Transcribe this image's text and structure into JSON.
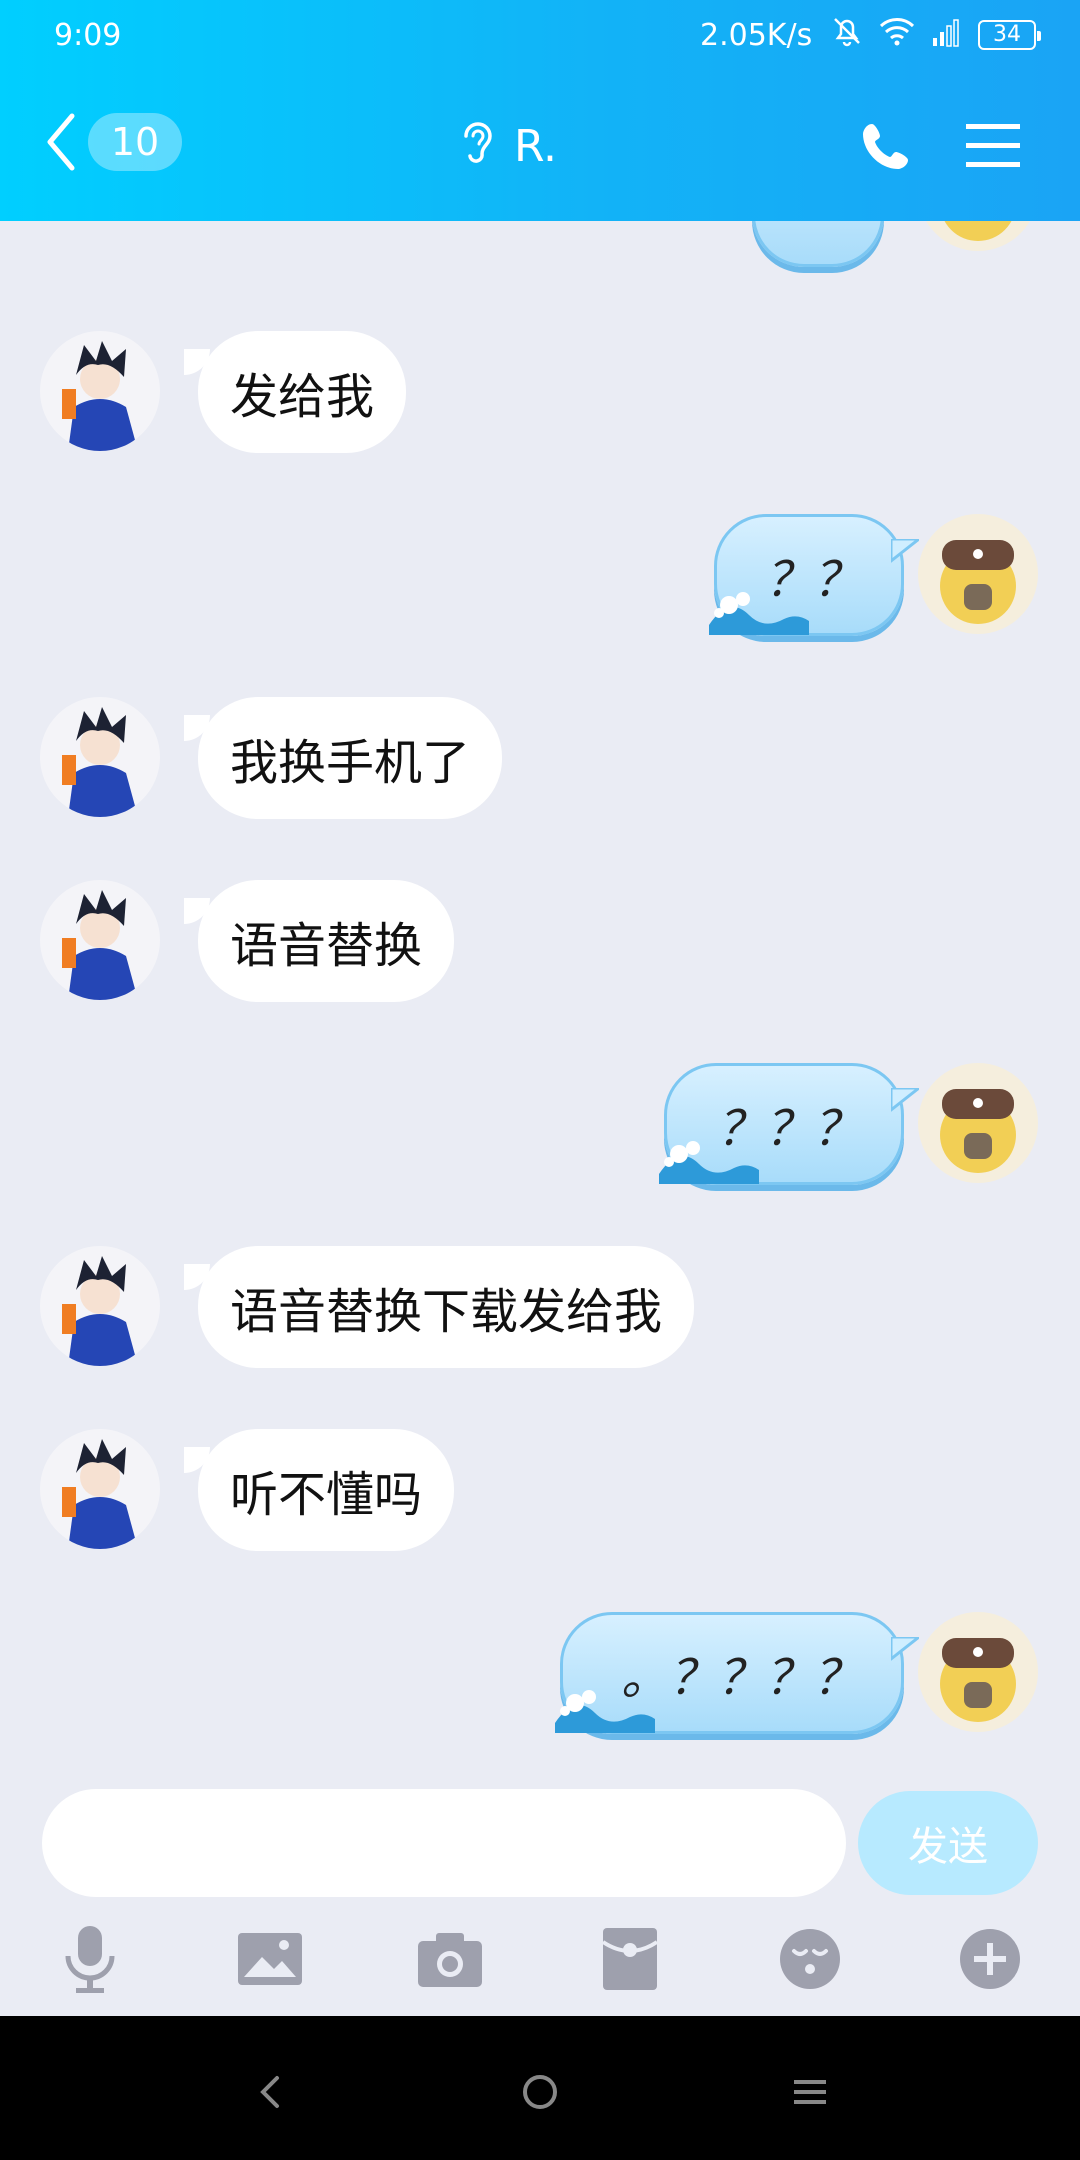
{
  "status": {
    "time": "9:09",
    "speed": "2.05K/s",
    "battery": "34"
  },
  "header": {
    "badge": "10",
    "title": "R."
  },
  "messages": [
    {
      "dir": "in",
      "text": "发给我"
    },
    {
      "dir": "out",
      "text": "？？"
    },
    {
      "dir": "in",
      "text": "我换手机了"
    },
    {
      "dir": "in",
      "text": "语音替换"
    },
    {
      "dir": "out",
      "text": "？？？"
    },
    {
      "dir": "in",
      "text": "语音替换下载发给我"
    },
    {
      "dir": "in",
      "text": "听不懂吗"
    },
    {
      "dir": "out",
      "text": "。？？？？"
    }
  ],
  "input": {
    "placeholder": "",
    "send_label": "发送"
  },
  "colors": {
    "header_start": "#00cfff",
    "header_end": "#1aa4f5",
    "chat_bg": "#eaecf4",
    "send_bg": "#b7eaff"
  },
  "icons": [
    "back-chevron-icon",
    "ear-icon",
    "phone-icon",
    "menu-icon",
    "mic-icon",
    "image-icon",
    "camera-icon",
    "red-packet-icon",
    "emoji-icon",
    "plus-icon"
  ]
}
